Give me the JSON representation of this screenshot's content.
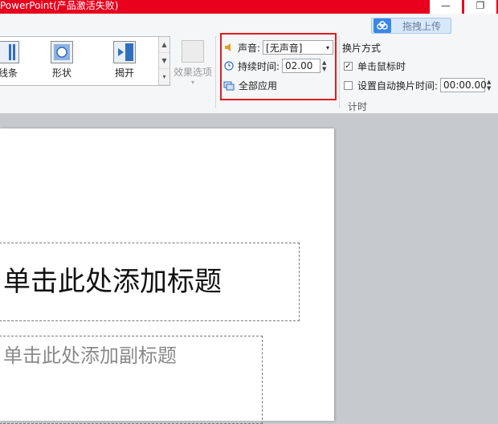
{
  "window": {
    "title": "PowerPoint(产品激活失败)",
    "minimize": "—",
    "restore": "❐"
  },
  "upload": {
    "label": "拖拽上传",
    "icon": "cloud-icon"
  },
  "gallery": {
    "items": [
      {
        "label": "线条",
        "icon": "lines-icon"
      },
      {
        "label": "形状",
        "icon": "shape-icon"
      },
      {
        "label": "揭开",
        "icon": "uncover-icon"
      }
    ]
  },
  "effect": {
    "label": "效果选项"
  },
  "timing": {
    "sound_label": "声音:",
    "sound_value": "[无声音]",
    "duration_label": "持续时间:",
    "duration_value": "02.00",
    "apply_all_label": "全部应用",
    "advance_title": "换片方式",
    "on_click_label": "单击鼠标时",
    "on_click_checked": true,
    "after_label": "设置自动换片时间:",
    "after_value": "00:00.00",
    "after_checked": false,
    "group_label": "计时"
  },
  "slide": {
    "title_placeholder": "单击此处添加标题",
    "subtitle_placeholder": "单击此处添加副标题"
  },
  "colors": {
    "titlebar": "#e8001c",
    "highlight": "#e21c1c",
    "accent": "#3b86e6"
  }
}
